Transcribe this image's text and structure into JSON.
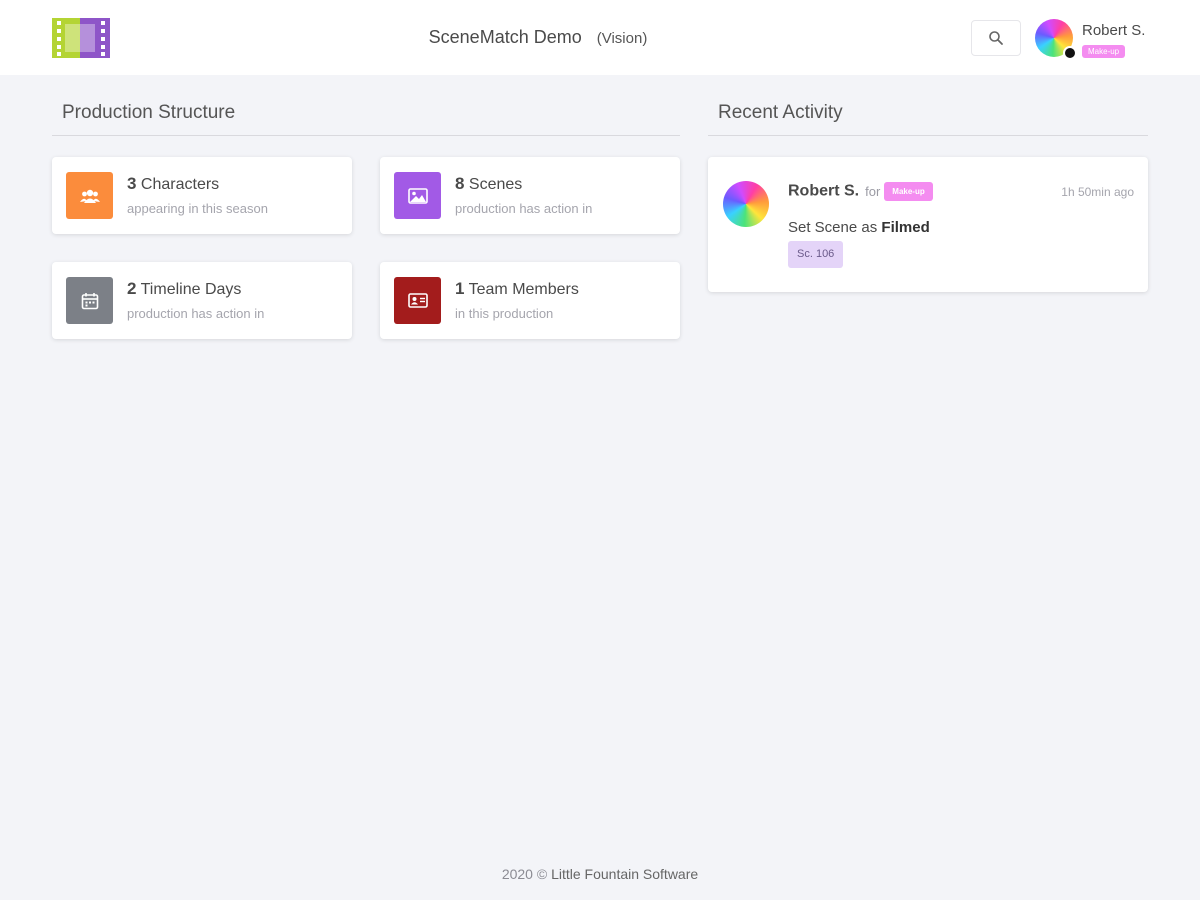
{
  "header": {
    "app_title": "SceneMatch Demo",
    "app_subtitle": "(Vision)",
    "user": {
      "name": "Robert S.",
      "role": "Make-up"
    },
    "icons": {
      "logo": "film-strip-logo",
      "search": "search-icon"
    }
  },
  "production": {
    "title": "Production Structure",
    "stats": [
      {
        "count": "3",
        "label": "Characters",
        "sub": "appearing in this season",
        "icon": "users-icon",
        "color": "#fb8c3c"
      },
      {
        "count": "8",
        "label": "Scenes",
        "sub": "production has action in",
        "icon": "image-icon",
        "color": "#a25ae6"
      },
      {
        "count": "2",
        "label": "Timeline Days",
        "sub": "production has action in",
        "icon": "calendar-icon",
        "color": "#7c8087"
      },
      {
        "count": "1",
        "label": "Team Members",
        "sub": "in this production",
        "icon": "id-card-icon",
        "color": "#a31c1c"
      }
    ]
  },
  "activity": {
    "title": "Recent Activity",
    "items": [
      {
        "user": "Robert S.",
        "for_text": "for",
        "role": "Make-up",
        "time": "1h 50min ago",
        "text_prefix": "Set Scene as",
        "text_bold": "Filmed",
        "tag": "Sc. 106"
      }
    ]
  },
  "footer": {
    "year": "2020 ©",
    "company": "Little Fountain Software"
  },
  "colors": {
    "role_badge": "#f48cf0",
    "scene_tag": "#e4d4f8",
    "background": "#f3f4f8"
  }
}
